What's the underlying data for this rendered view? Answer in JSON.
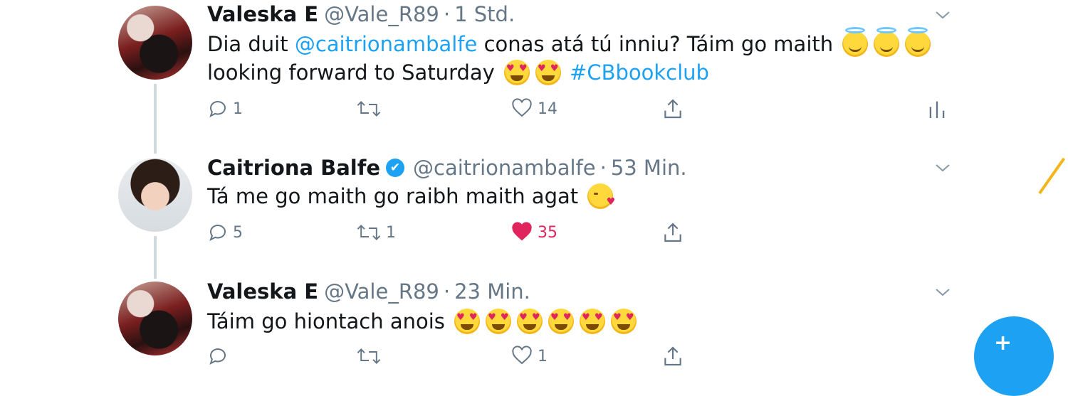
{
  "tweets": [
    {
      "name": "Valeska E",
      "handle": "@Vale_R89",
      "separator": "·",
      "time": "1 Std.",
      "text_line1_pre": "Dia duit ",
      "mention": "@caitrionambalfe",
      "text_line1_post": " conas atá tú inniu? Táim go maith ",
      "text_line2_pre": "looking forward to Saturday ",
      "hashtag": "#CBbookclub",
      "reply_count": "1",
      "retweet_count": "",
      "like_count": "14"
    },
    {
      "name": "Caitriona Balfe",
      "verified_icon": "✔",
      "handle": "@caitrionambalfe",
      "separator": "·",
      "time": "53 Min.",
      "text": "Tá me go maith go raibh maith agat ",
      "reply_count": "5",
      "retweet_count": "1",
      "like_count": "35",
      "liked": true
    },
    {
      "name": "Valeska E",
      "handle": "@Vale_R89",
      "separator": "·",
      "time": "23 Min.",
      "text": "Táim go hiontach anois ",
      "reply_count": "",
      "retweet_count": "",
      "like_count": "1"
    }
  ],
  "fab": {
    "icon": "compose-tweet-icon",
    "label": "+"
  },
  "colors": {
    "accent": "#1da1f2",
    "like": "#e0245e",
    "muted": "#657786"
  }
}
